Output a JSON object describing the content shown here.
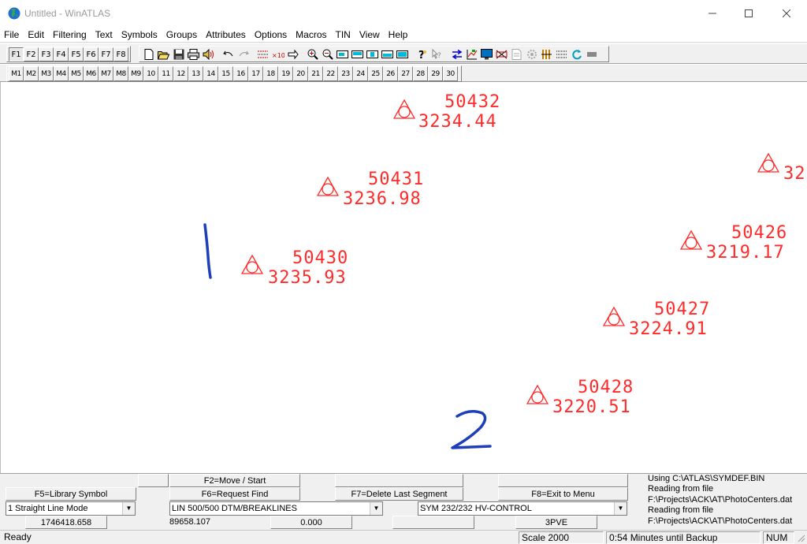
{
  "window": {
    "title": "Untitled - WinATLAS"
  },
  "menu": [
    "File",
    "Edit",
    "Filtering",
    "Text",
    "Symbols",
    "Groups",
    "Attributes",
    "Options",
    "Macros",
    "TIN",
    "View",
    "Help"
  ],
  "toolbar": {
    "function_keys": [
      "F1",
      "F2",
      "F3",
      "F4",
      "F5",
      "F6",
      "F7",
      "F8"
    ],
    "macro_keys": [
      "M1",
      "M2",
      "M3",
      "M4",
      "M5",
      "M6",
      "M7",
      "M8",
      "M9",
      "10",
      "11",
      "12",
      "13",
      "14",
      "15",
      "16",
      "17",
      "18",
      "19",
      "20",
      "21",
      "22",
      "23",
      "24",
      "25",
      "26",
      "27",
      "28",
      "29",
      "30"
    ],
    "icons": [
      "new-file-icon",
      "open-folder-icon",
      "save-icon",
      "print-icon",
      "speaker-icon",
      "undo-icon",
      "redo-icon",
      "grid-dots-icon",
      "delete-x-icon",
      "arrow-right-icon",
      "zoom-in-icon",
      "zoom-out-icon",
      "view-1-icon",
      "view-2-icon",
      "view-3-icon",
      "view-4-icon",
      "view-5-icon",
      "help-icon",
      "context-help-icon",
      "swap-arrows-icon",
      "chart-icon",
      "monitor-icon",
      "layers-icon",
      "document-icon",
      "gear-icon",
      "columns-icon",
      "dotgrid-icon",
      "refresh-icon",
      "minus-icon"
    ]
  },
  "canvas": {
    "points": [
      {
        "id": "50432",
        "elev": "3234.44"
      },
      {
        "id": "50431",
        "elev": "3236.98"
      },
      {
        "id": "50430",
        "elev": "3235.93"
      },
      {
        "id": "32",
        "elev": ""
      },
      {
        "id": "50426",
        "elev": "3219.17"
      },
      {
        "id": "50427",
        "elev": "3224.91"
      },
      {
        "id": "50428",
        "elev": "3220.51"
      }
    ],
    "handwriting": [
      "1",
      "2"
    ],
    "symbol_color": "#ff2a2a",
    "ink_color": "#1e3fb8"
  },
  "panel": {
    "buttons": {
      "f5": "F5=Library Symbol",
      "f2": "F2=Move / Start",
      "f6": "F6=Request Find",
      "f7": "F7=Delete Last Segment",
      "f8": "F8=Exit to Menu"
    },
    "mode_select": "1 Straight Line Mode",
    "line_select": "LIN 500/500 DTM/BREAKLINES",
    "symbol_select": "SYM 232/232 HV-CONTROL",
    "coord_x": "1746418.658",
    "coord_y": "89658.107",
    "coord_z": "0.000",
    "code": "3PVE",
    "messages": [
      "Using C:\\ATLAS\\SYMDEF.BIN",
      "Reading from file",
      "F:\\Projects\\ACK\\AT\\PhotoCenters.dat",
      "Reading from file",
      "F:\\Projects\\ACK\\AT\\PhotoCenters.dat"
    ]
  },
  "status": {
    "ready": "Ready",
    "scale": "Scale  2000",
    "backup": "0:54 Minutes until Backup",
    "num": "NUM"
  }
}
